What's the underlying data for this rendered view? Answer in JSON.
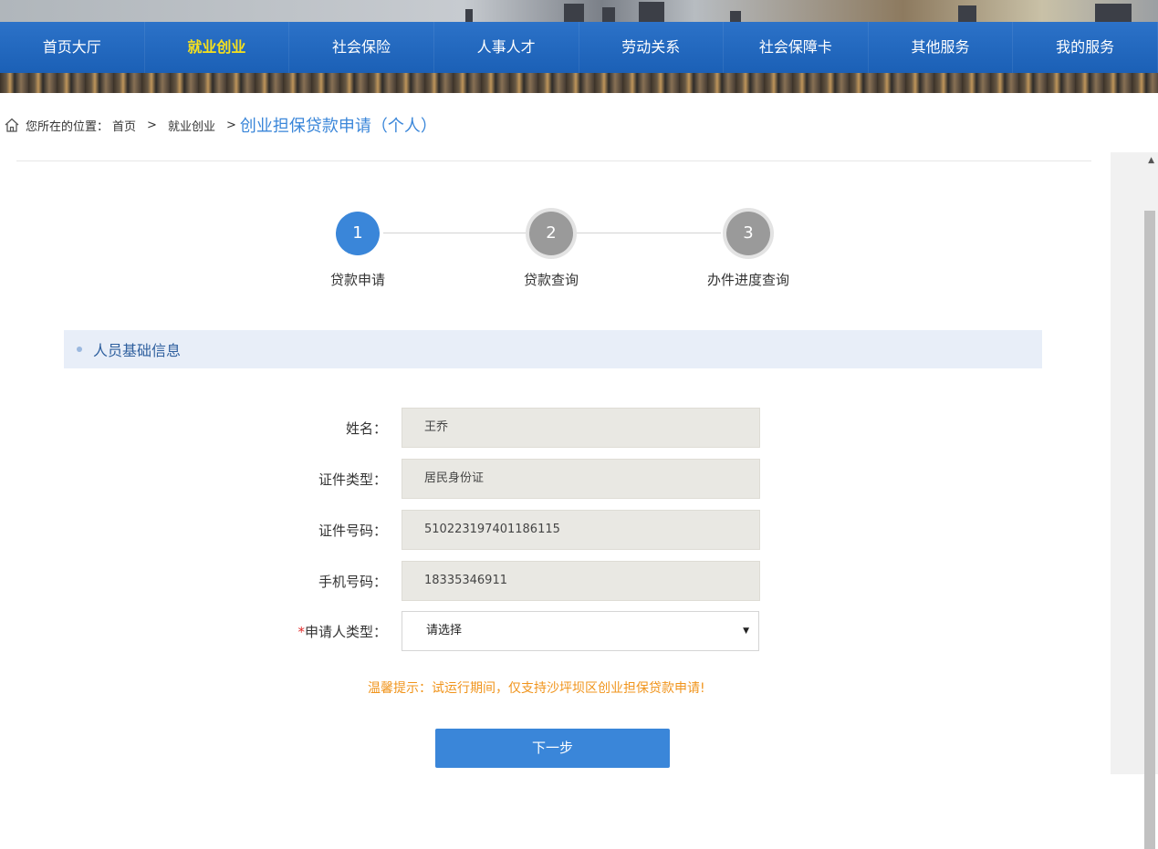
{
  "nav": {
    "items": [
      {
        "label": "首页大厅"
      },
      {
        "label": "就业创业"
      },
      {
        "label": "社会保险"
      },
      {
        "label": "人事人才"
      },
      {
        "label": "劳动关系"
      },
      {
        "label": "社会保障卡"
      },
      {
        "label": "其他服务"
      },
      {
        "label": "我的服务"
      }
    ],
    "active_index": 1
  },
  "breadcrumb": {
    "icon": "home-icon",
    "prefix": "您所在的位置：",
    "home": "首页",
    "separator": ">",
    "section": "就业创业",
    "current": "创业担保贷款申请（个人）"
  },
  "steps": [
    {
      "number": "1",
      "label": "贷款申请"
    },
    {
      "number": "2",
      "label": "贷款查询"
    },
    {
      "number": "3",
      "label": "办件进度查询"
    }
  ],
  "active_step": 1,
  "section_title": "人员基础信息",
  "form": {
    "name": {
      "label": "姓名：",
      "value": "王乔"
    },
    "id_type": {
      "label": "证件类型：",
      "value": "居民身份证"
    },
    "id_number": {
      "label": "证件号码：",
      "value": "510223197401186115"
    },
    "phone": {
      "label": "手机号码：",
      "value": "18335346911"
    },
    "applicant_type": {
      "required_mark": "*",
      "label": "申请人类型：",
      "selected": "请选择"
    }
  },
  "tip": "温馨提示：试运行期间，仅支持沙坪坝区创业担保贷款申请!",
  "next_button": "下一步",
  "colors": {
    "nav_blue": "#1d5fb3",
    "active_nav": "#f5e01e",
    "accent": "#3a86d9",
    "tip": "#f0941c"
  }
}
